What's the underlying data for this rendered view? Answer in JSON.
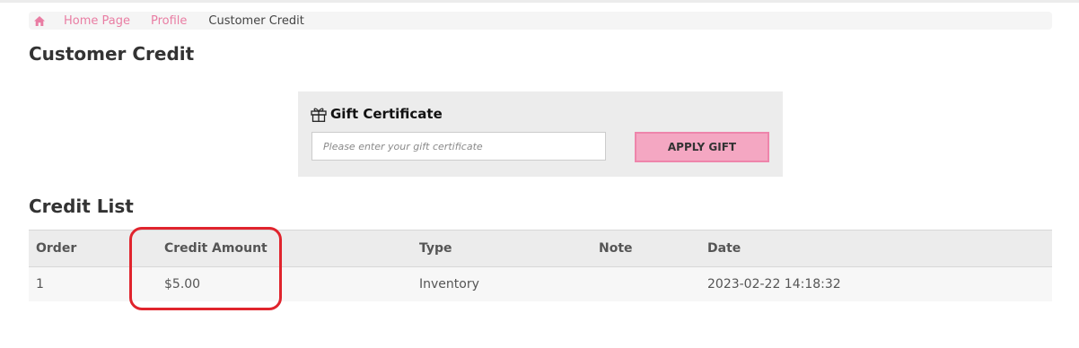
{
  "breadcrumb": {
    "home_icon": "home-icon",
    "items": [
      "Home Page",
      "Profile"
    ],
    "current": "Customer Credit"
  },
  "page_title": "Customer Credit",
  "gift": {
    "icon": "gift-icon",
    "title": "Gift Certificate",
    "input_placeholder": "Please enter your gift certificate",
    "input_value": "",
    "apply_label": "APPLY GIFT"
  },
  "credit_list": {
    "title": "Credit List",
    "columns": [
      "Order",
      "Credit Amount",
      "Type",
      "Note",
      "Date"
    ],
    "rows": [
      {
        "order": "1",
        "amount": "$5.00",
        "type": "Inventory",
        "note": "",
        "date": "2023-02-22 14:18:32"
      }
    ]
  },
  "colors": {
    "accent_pink": "#e97da3",
    "button_bg": "#f4a7c2",
    "highlight_red": "#e0242d"
  }
}
